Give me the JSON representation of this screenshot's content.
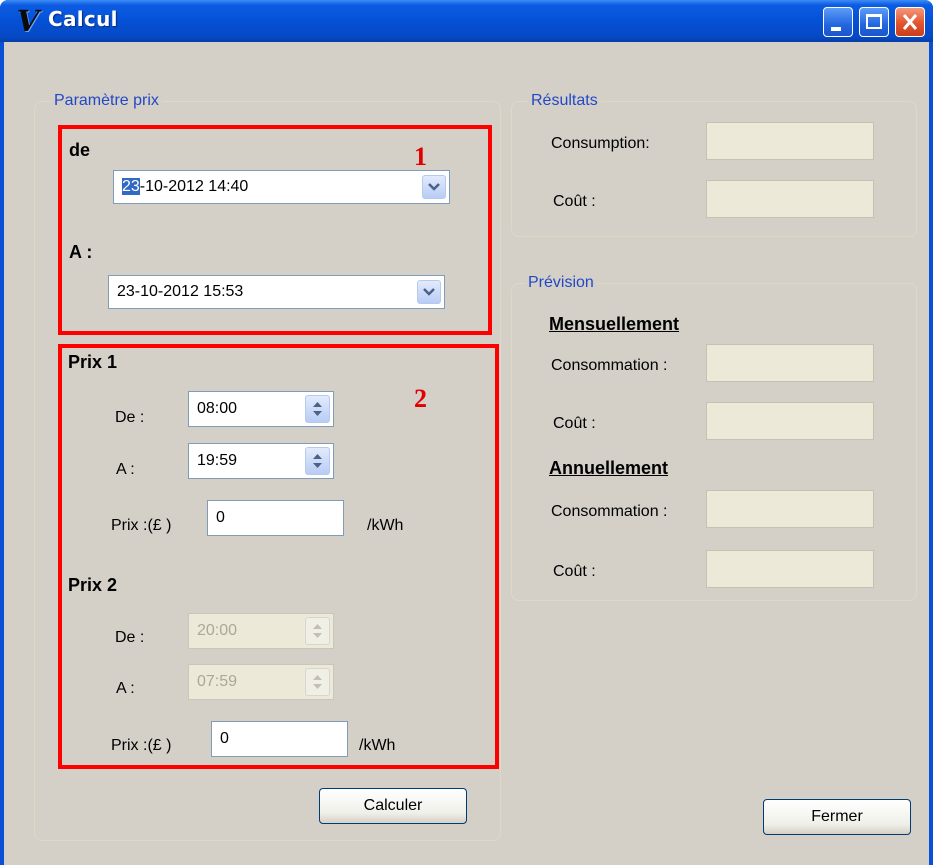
{
  "window": {
    "title": "Calcul",
    "logo": "V",
    "controls": [
      "minimize",
      "maximize",
      "close"
    ]
  },
  "params": {
    "legend": "Paramètre prix",
    "de_label": "de",
    "de_value_selected": "23",
    "de_value_rest": "-10-2012 14:40",
    "a_label": "A :",
    "a_value": "23-10-2012 15:53",
    "prix1": {
      "title": "Prix 1",
      "de_label": "De :",
      "de_value": "08:00",
      "a_label": "A :",
      "a_value": "19:59",
      "prix_label": "Prix :(£ )",
      "prix_value": "0",
      "unit": "/kWh"
    },
    "prix2": {
      "title": "Prix 2",
      "de_label": "De :",
      "de_value": "20:00",
      "a_label": "A :",
      "a_value": "07:59",
      "prix_label": "Prix :(£ )",
      "prix_value": "0",
      "unit": "/kWh"
    },
    "calc_button": "Calculer"
  },
  "resultats": {
    "legend": "Résultats",
    "consumption_label": "Consumption:",
    "cout_label": "Coût :",
    "consumption_value": "",
    "cout_value": ""
  },
  "prevision": {
    "legend": "Prévision",
    "mensuel_title": "Mensuellement",
    "mensuel_conso_label": "Consommation :",
    "mensuel_cout_label": "Coût :",
    "annuel_title": "Annuellement",
    "annuel_conso_label": "Consommation :",
    "annuel_cout_label": "Coût :"
  },
  "close_button": "Fermer",
  "annotations": [
    "1",
    "2"
  ],
  "colors": {
    "titlebar": "#0551d6",
    "client_bg": "#d4d0c8",
    "annotation": "#ff0000",
    "legend_text": "#2348c6"
  }
}
